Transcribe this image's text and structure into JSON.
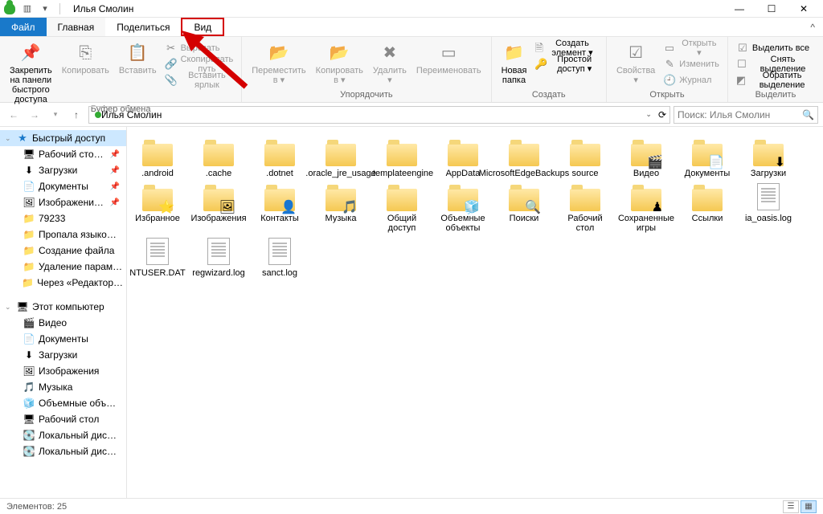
{
  "window": {
    "title": "Илья Смолин"
  },
  "tabs": {
    "file": "Файл",
    "home": "Главная",
    "share": "Поделиться",
    "view": "Вид"
  },
  "ribbon": {
    "clipboard": {
      "pin": "Закрепить на панели\nбыстрого доступа",
      "copy": "Копировать",
      "paste": "Вставить",
      "cut": "Вырезать",
      "copypath": "Скопировать путь",
      "pastelink": "Вставить ярлык",
      "label": "Буфер обмена"
    },
    "organize": {
      "moveto": "Переместить\nв ▾",
      "copyto": "Копировать\nв ▾",
      "delete": "Удалить\n▾",
      "rename": "Переименовать",
      "label": "Упорядочить"
    },
    "new": {
      "newfolder": "Новая\nпапка",
      "newitem": "Создать элемент ▾",
      "easyaccess": "Простой доступ ▾",
      "label": "Создать"
    },
    "open": {
      "properties": "Свойства\n▾",
      "open": "Открыть ▾",
      "edit": "Изменить",
      "history": "Журнал",
      "label": "Открыть"
    },
    "select": {
      "selectall": "Выделить все",
      "selectnone": "Снять выделение",
      "invert": "Обратить выделение",
      "label": "Выделить"
    }
  },
  "address": {
    "path": "Илья Смолин",
    "search_placeholder": "Поиск: Илья Смолин"
  },
  "sidebar": {
    "quickaccess": "Быстрый доступ",
    "items_pinned": [
      "Рабочий сто…",
      "Загрузки",
      "Документы",
      "Изображени…"
    ],
    "items_recent": [
      "79233",
      "Пропала языко…",
      "Создание файла",
      "Удаление парам…",
      "Через «Редактор…"
    ],
    "thispc": "Этот компьютер",
    "thispc_items": [
      "Видео",
      "Документы",
      "Загрузки",
      "Изображения",
      "Музыка",
      "Объемные объ…",
      "Рабочий стол",
      "Локальный дис…",
      "Локальный дис…"
    ]
  },
  "files": [
    {
      "name": ".android",
      "type": "folder"
    },
    {
      "name": ".cache",
      "type": "folder"
    },
    {
      "name": ".dotnet",
      "type": "folder"
    },
    {
      "name": ".oracle_jre_usage",
      "type": "folder"
    },
    {
      "name": ".templateengine",
      "type": "folder"
    },
    {
      "name": "AppData",
      "type": "folder"
    },
    {
      "name": "MicrosoftEdgeBackups",
      "type": "folder"
    },
    {
      "name": "source",
      "type": "folder"
    },
    {
      "name": "Видео",
      "type": "folder",
      "badge": "🎬"
    },
    {
      "name": "Документы",
      "type": "folder",
      "badge": "📄"
    },
    {
      "name": "Загрузки",
      "type": "folder",
      "badge": "⬇"
    },
    {
      "name": "Избранное",
      "type": "folder",
      "badge": "⭐"
    },
    {
      "name": "Изображения",
      "type": "folder",
      "badge": "🖼"
    },
    {
      "name": "Контакты",
      "type": "folder",
      "badge": "👤"
    },
    {
      "name": "Музыка",
      "type": "folder",
      "badge": "🎵"
    },
    {
      "name": "Общий доступ",
      "type": "folder"
    },
    {
      "name": "Объемные объекты",
      "type": "folder",
      "badge": "🧊"
    },
    {
      "name": "Поиски",
      "type": "folder",
      "badge": "🔍"
    },
    {
      "name": "Рабочий стол",
      "type": "folder"
    },
    {
      "name": "Сохраненные игры",
      "type": "folder",
      "badge": "♟"
    },
    {
      "name": "Ссылки",
      "type": "folder"
    },
    {
      "name": "ia_oasis.log",
      "type": "file"
    },
    {
      "name": "NTUSER.DAT",
      "type": "file"
    },
    {
      "name": "regwizard.log",
      "type": "file"
    },
    {
      "name": "sanct.log",
      "type": "file"
    }
  ],
  "status": {
    "count": "Элементов: 25"
  }
}
